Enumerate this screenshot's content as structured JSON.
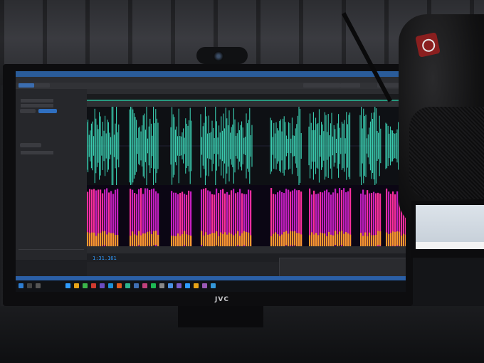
{
  "monitor": {
    "brand": "JVC"
  },
  "app": {
    "time_display": "1:31.161"
  },
  "colors": {
    "waveform": "#3fe0c0",
    "spectral_hot": "#ff2fa0",
    "spectral_warm": "#ff9a30",
    "titlebar": "#2a5c9a",
    "accent_blue": "#2f9bff"
  },
  "icons": [
    "webcam",
    "microphone",
    "shock-mount",
    "windows-start-icon"
  ]
}
